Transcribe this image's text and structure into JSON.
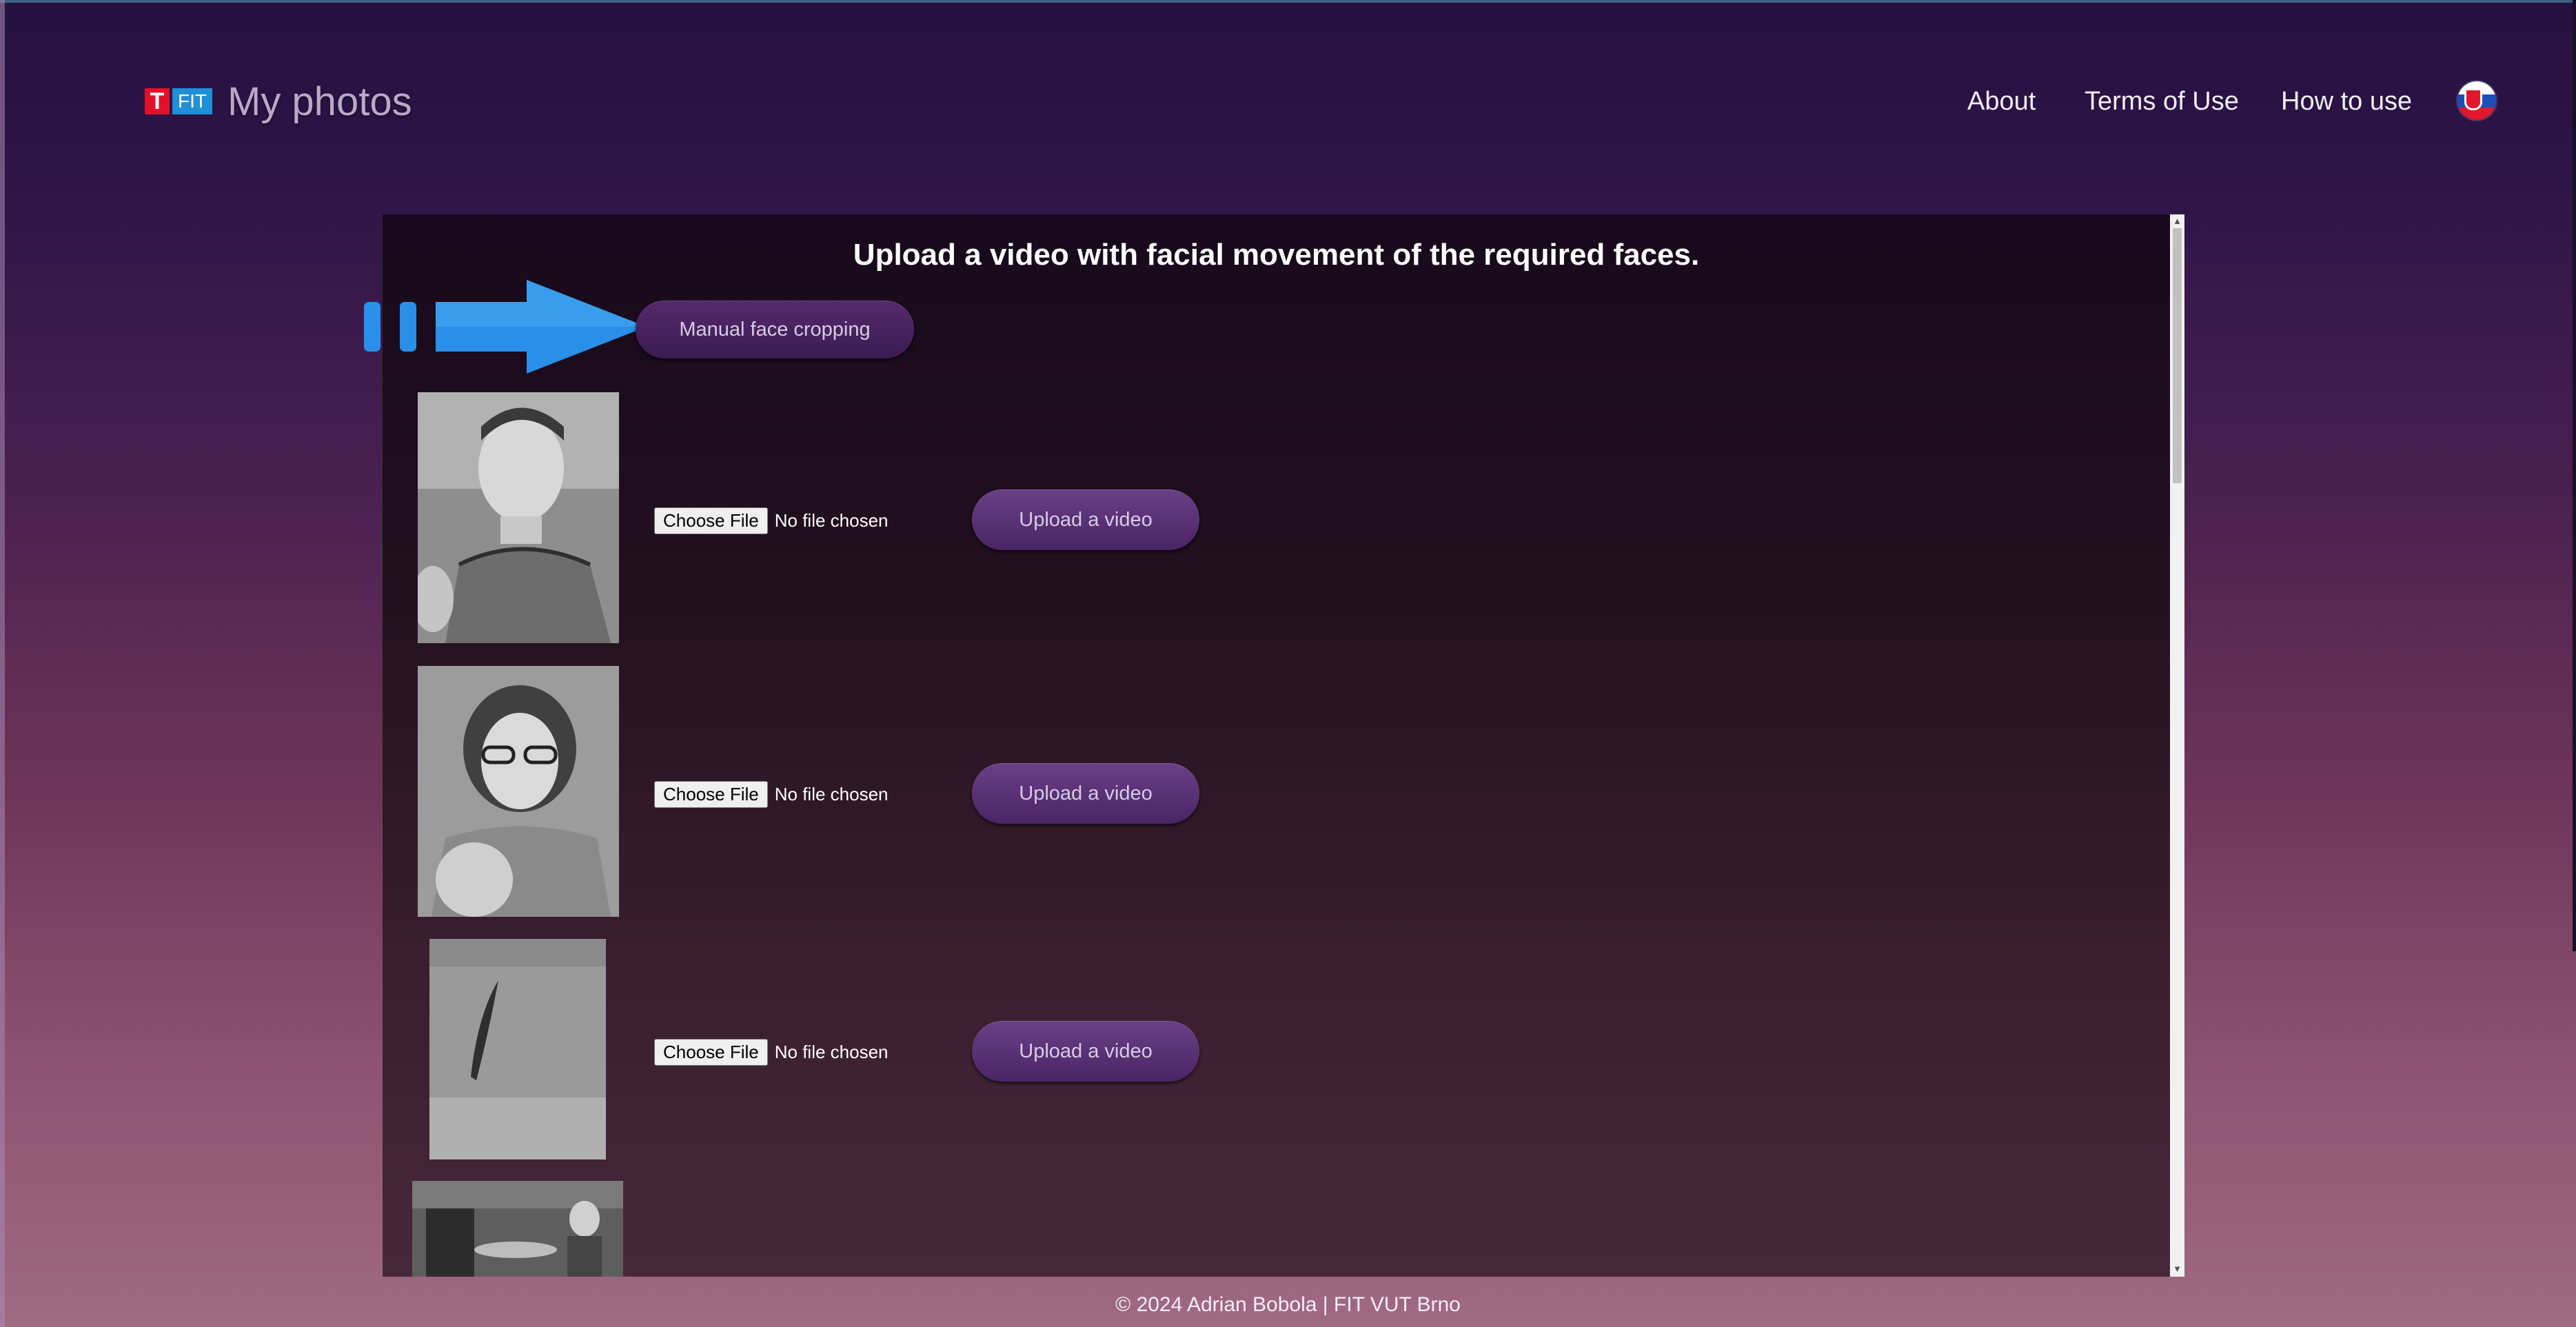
{
  "header": {
    "logo": {
      "t_mark": "T",
      "fit_mark": "FIT"
    },
    "app_title": "My photos",
    "nav": {
      "about": "About",
      "terms": "Terms of Use",
      "how_to_use": "How to use"
    },
    "language_flag": "slovak-flag-icon"
  },
  "panel": {
    "heading": "Upload a video with facial movement of the required faces.",
    "manual_crop_label": "Manual face cropping",
    "arrow_icon": "right-arrow-icon",
    "rows": [
      {
        "photo": "man-with-child-photo",
        "choose_label": "Choose File",
        "file_status": "No file chosen",
        "upload_label": "Upload a video"
      },
      {
        "photo": "woman-with-baby-photo",
        "choose_label": "Choose File",
        "file_status": "No file chosen",
        "upload_label": "Upload a video"
      },
      {
        "photo": "blurry-face-photo",
        "choose_label": "Choose File",
        "file_status": "No file chosen",
        "upload_label": "Upload a video"
      },
      {
        "photo": "child-at-table-photo"
      }
    ]
  },
  "footer": {
    "text": "© 2024 Adrian Bobola | FIT VUT Brno"
  },
  "colors": {
    "accent_button": "#5a2f78",
    "arrow_blue": "#2a8fe8",
    "logo_red": "#e3102b",
    "logo_blue": "#1f8fd6"
  }
}
